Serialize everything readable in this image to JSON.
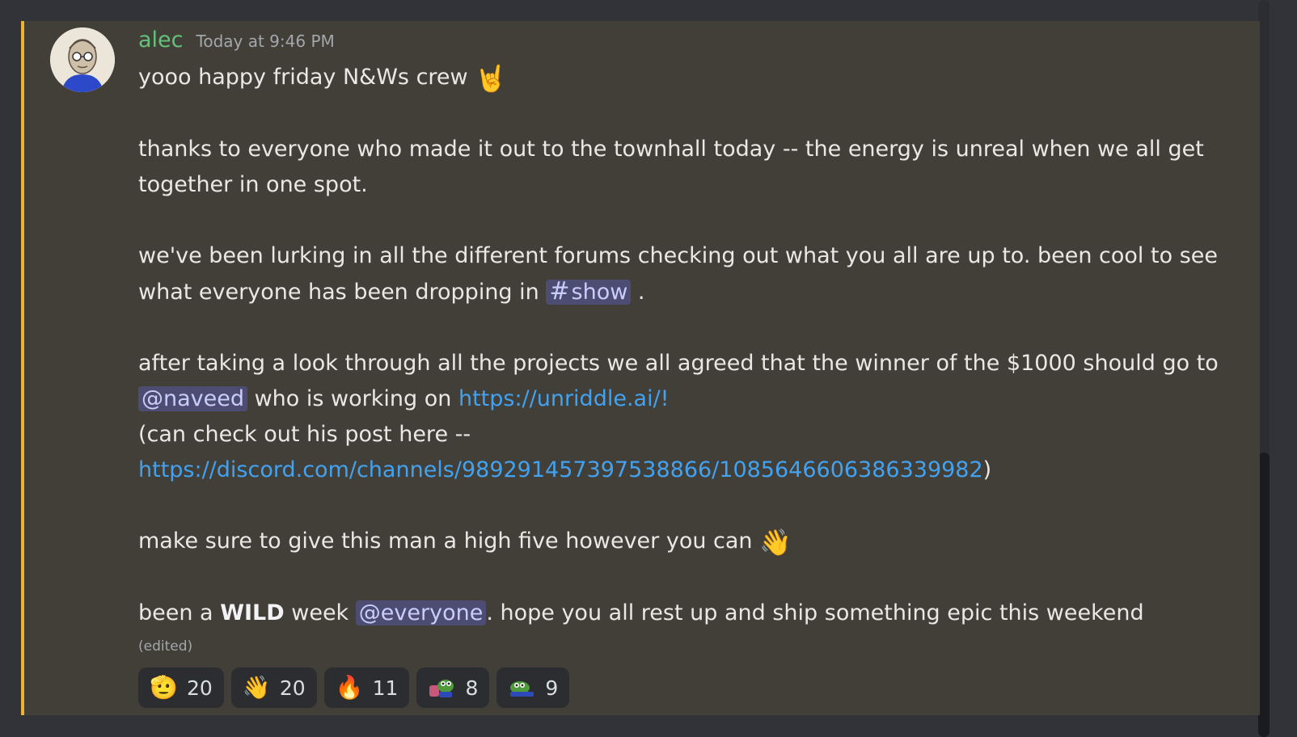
{
  "message": {
    "username": "alec",
    "timestamp": "Today at 9:46 PM",
    "line1": "yooo happy friday N&Ws crew",
    "line1_emoji": "🤘",
    "para2": "thanks to everyone who made it out to the townhall today -- the energy is unreal when we all get together in one spot.",
    "para3_text": "we've been lurking in all the different forums checking out what you all are up to. been cool to see what everyone has been dropping in",
    "channel_hash": "#",
    "channel_name": "show",
    "para3_end": ".",
    "para4_text": "after taking a look through all the projects we all agreed that the winner of the $1000 should go to",
    "mention_user": "@naveed",
    "para4_mid": "who is working on",
    "link1": "https://unriddle.ai/!",
    "para5_text": "(can check out his post here --",
    "link2": "https://discord.com/channels/989291457397538866/1085646606386339982",
    "para5_end": ")",
    "para6_text": "make sure to give this man a high five however you can",
    "para6_emoji": "👋",
    "para7_start": "been a",
    "para7_bold": "WILD",
    "para7_week": "week",
    "mention_everyone": "@everyone",
    "para7_end": ". hope you all rest up and ship something epic this weekend",
    "edited": "(edited)"
  },
  "reactions": [
    {
      "icon": "salute-face-emoji",
      "glyph": "🫡",
      "count": "20"
    },
    {
      "icon": "waving-hand-emoji",
      "glyph": "👋",
      "count": "20"
    },
    {
      "icon": "fire-emoji",
      "glyph": "🔥",
      "count": "11"
    },
    {
      "icon": "pepe-custom-emoji",
      "glyph": "",
      "count": "8"
    },
    {
      "icon": "pepe-lying-custom-emoji",
      "glyph": "",
      "count": "9"
    }
  ],
  "colors": {
    "highlight_bar": "#f0b232",
    "username": "#63c27a",
    "link": "#43a2ef",
    "mention_bg": "#4d4d73"
  }
}
